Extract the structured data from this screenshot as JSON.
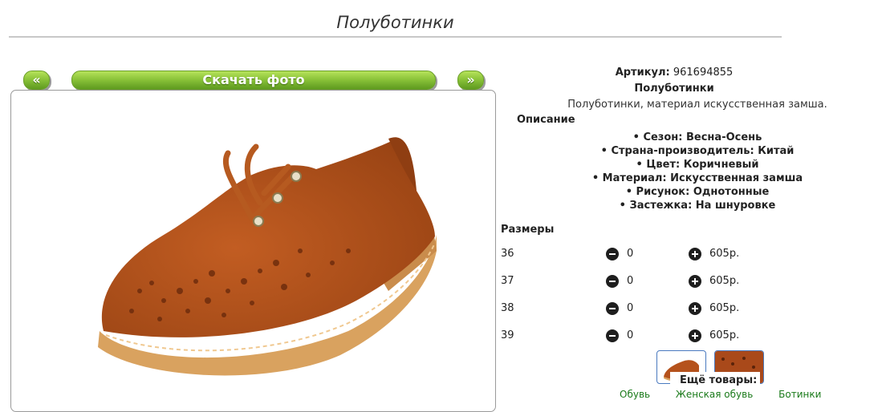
{
  "page": {
    "title": "Полуботинки"
  },
  "nav": {
    "prev": "«",
    "download": "Скачать фото",
    "next": "»"
  },
  "product": {
    "sku_label": "Артикул:",
    "sku": "961694855",
    "name": "Полуботинки",
    "description": "Полуботинки, материал искусственная замша.",
    "description_heading": "Описание",
    "attributes": [
      "Сезон: Весна-Осень",
      "Страна-производитель: Китай",
      "Цвет: Коричневый",
      "Материал: Искусственная замша",
      "Рисунок: Однотонные",
      "Застежка: На шнуровке"
    ]
  },
  "sizes": {
    "heading": "Размеры",
    "rows": [
      {
        "size": "36",
        "qty": "0",
        "price": "605р."
      },
      {
        "size": "37",
        "qty": "0",
        "price": "605р."
      },
      {
        "size": "38",
        "qty": "0",
        "price": "605р."
      },
      {
        "size": "39",
        "qty": "0",
        "price": "605р."
      }
    ]
  },
  "more": {
    "heading": "Ещё товары:",
    "links": [
      "Обувь",
      "Женская обувь",
      "Ботинки"
    ]
  },
  "colors": {
    "accent_green": "#8cc43a",
    "shoe": "#b5521c",
    "sole": "#d9a25f"
  }
}
